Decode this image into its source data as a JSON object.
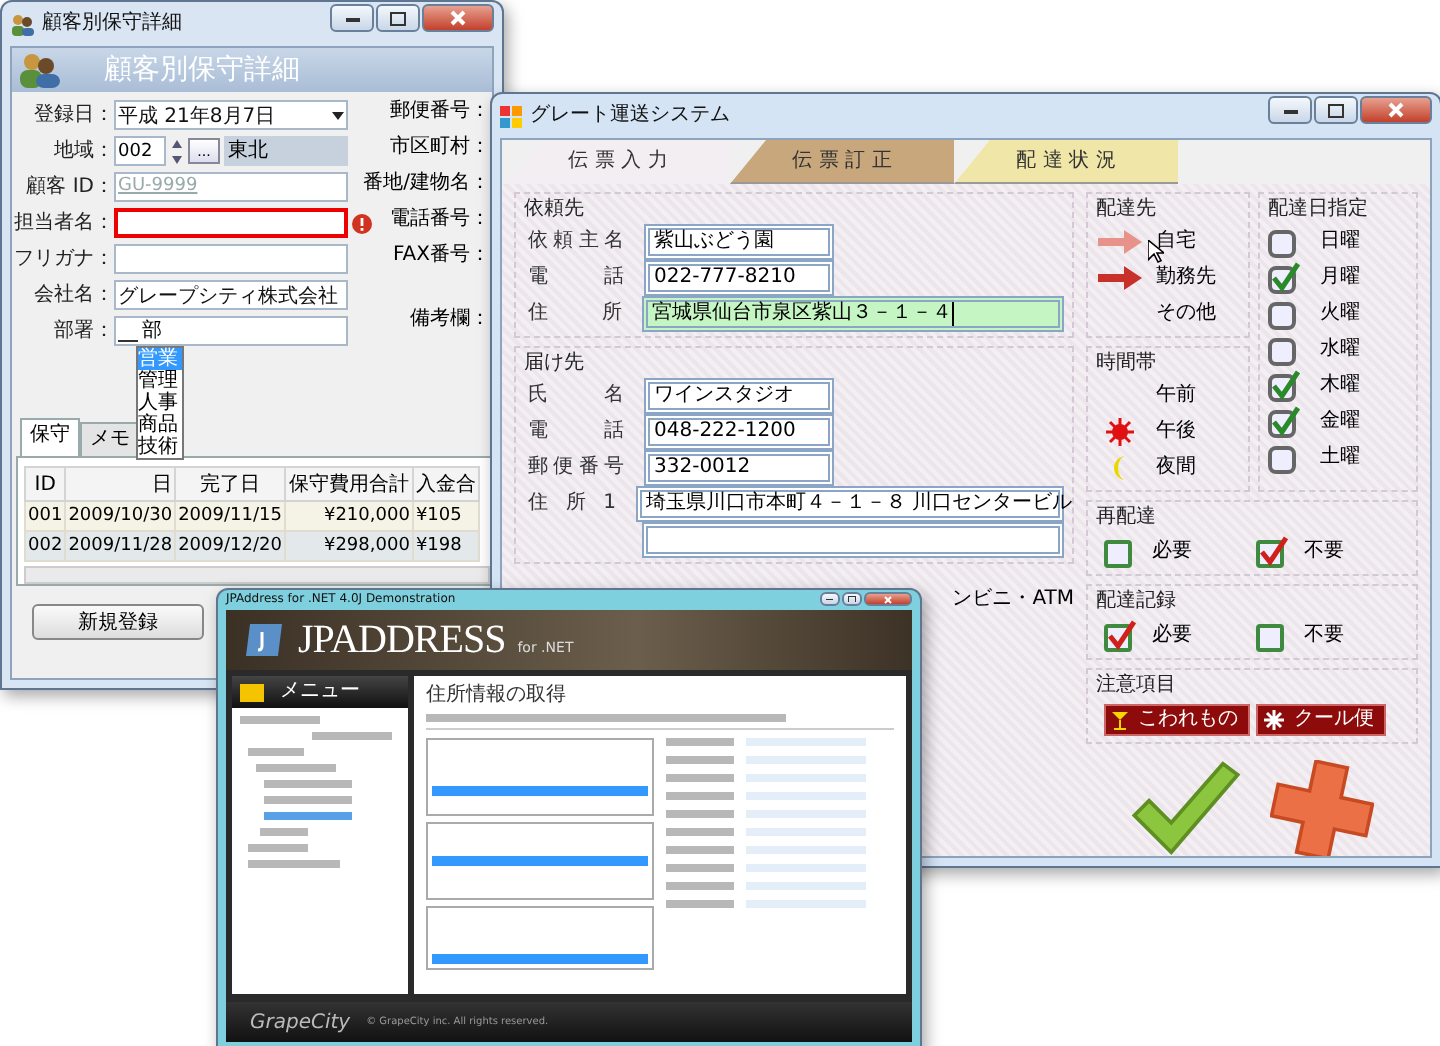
{
  "customer_window": {
    "title": "顧客別保守詳細",
    "banner": "顧客別保守詳細",
    "fields": [
      {
        "label": "登録日：",
        "kind": "dropdown",
        "value": "平成 21年8月7日",
        "error": false
      },
      {
        "label": "地域：",
        "kind": "area",
        "value": "002",
        "button": "...",
        "area_name": "東北",
        "error": false
      },
      {
        "label": "顧客 ID：",
        "kind": "masked",
        "placeholder": "GU-9999",
        "error": false
      },
      {
        "label": "担当者名：",
        "kind": "text",
        "error": true
      },
      {
        "label": "フリガナ：",
        "kind": "text",
        "error": false
      },
      {
        "label": "会社名：",
        "kind": "text",
        "value": "グレープシティ株式会社",
        "error": false
      },
      {
        "label": "部署：",
        "kind": "department",
        "value": "部",
        "error": false,
        "options": [
          {
            "label": "営業",
            "selected": true
          },
          {
            "label": "管理",
            "selected": false
          },
          {
            "label": "人事",
            "selected": false
          },
          {
            "label": "商品",
            "selected": false
          },
          {
            "label": "技術",
            "selected": false
          }
        ]
      }
    ],
    "right_labels": [
      "郵便番号：",
      "市区町村：",
      "番地/建物名：",
      "電話番号：",
      "FAX番号：",
      "備考欄："
    ],
    "tabs": [
      {
        "label": "保守",
        "selected": true
      },
      {
        "label": "メモ",
        "selected": false
      }
    ],
    "table": {
      "columns": [
        "ID",
        "日",
        "完了日",
        "保守費用合計",
        "入金合"
      ],
      "rows": [
        [
          "001",
          "2009/10/30",
          "2009/11/15",
          "¥210,000",
          "¥105"
        ],
        [
          "002",
          "2009/11/28",
          "2009/12/20",
          "¥298,000",
          "¥198"
        ]
      ]
    },
    "buttons": [
      "新規登録"
    ]
  },
  "shipping_window": {
    "title": "グレート運送システム",
    "tabs": [
      {
        "label": "伝 票 入 力",
        "selected": true,
        "color": "#f2eef2"
      },
      {
        "label": "伝 票 訂 正",
        "selected": false,
        "color": "#c9a77c"
      },
      {
        "label": "配 達 状 況",
        "selected": false,
        "color": "#f0e6a8"
      }
    ],
    "sender": {
      "title": "依頼先",
      "fields": [
        {
          "label": "依頼主名",
          "value": "紫山ぶどう園",
          "kind": "short",
          "focused": false
        },
        {
          "label": "電話",
          "value": "022-777-8210",
          "kind": "short",
          "focused": false
        },
        {
          "label": "住所",
          "value": "宮城県仙台市泉区紫山３－１－４",
          "kind": "long",
          "focused": true
        }
      ]
    },
    "recipient": {
      "title": "届け先",
      "fields": [
        {
          "label": "氏名",
          "value": "ワインスタジオ",
          "kind": "short",
          "focused": false
        },
        {
          "label": "電話",
          "value": "048-222-1200",
          "kind": "short",
          "focused": false
        },
        {
          "label": "郵便番号",
          "value": "332-0012",
          "kind": "short",
          "focused": false
        },
        {
          "label": "住所1",
          "value": "埼玉県川口市本町４－１－８ 川口センタービル",
          "kind": "long",
          "focused": false
        },
        {
          "kind": "long",
          "focused": false
        }
      ],
      "extra": "ンビニ・ATM"
    },
    "destination": {
      "title": "配達先",
      "options": [
        {
          "label": "自宅",
          "selected": false,
          "hovered": true
        },
        {
          "label": "勤務先",
          "selected": true,
          "hovered": false
        },
        {
          "label": "その他",
          "selected": false,
          "hovered": false
        }
      ]
    },
    "time_slot": {
      "title": "時間帯",
      "options": [
        {
          "label": "午前",
          "kind": "plain"
        },
        {
          "label": "午後",
          "kind": "sun"
        },
        {
          "label": "夜間",
          "kind": "moon"
        }
      ]
    },
    "days": {
      "title": "配達日指定",
      "options": [
        {
          "label": "日曜",
          "checked": false
        },
        {
          "label": "月曜",
          "checked": true
        },
        {
          "label": "火曜",
          "checked": false
        },
        {
          "label": "水曜",
          "checked": false
        },
        {
          "label": "木曜",
          "checked": true
        },
        {
          "label": "金曜",
          "checked": true
        },
        {
          "label": "土曜",
          "checked": false
        }
      ]
    },
    "redelivery": {
      "title": "再配達",
      "options": [
        {
          "label": "必要",
          "checked": false
        },
        {
          "label": "不要",
          "checked": true
        }
      ]
    },
    "record": {
      "title": "配達記録",
      "options": [
        {
          "label": "必要",
          "checked": true
        },
        {
          "label": "不要",
          "checked": false
        }
      ]
    },
    "caution": {
      "title": "注意項目",
      "items": [
        {
          "label": "こわれもの",
          "kind": "fragile"
        },
        {
          "label": "クール便",
          "kind": "cool"
        }
      ]
    }
  },
  "address_window": {
    "title": "JPAddress for .NET 4.0J Demonstration",
    "logo": "JPADDRESS",
    "logo_suffix": "for .NET",
    "menu_title": "メニュー",
    "heading": "住所情報の取得",
    "footer_logo": "GrapeCity",
    "copyright": "© GrapeCity inc. All rights reserved."
  }
}
